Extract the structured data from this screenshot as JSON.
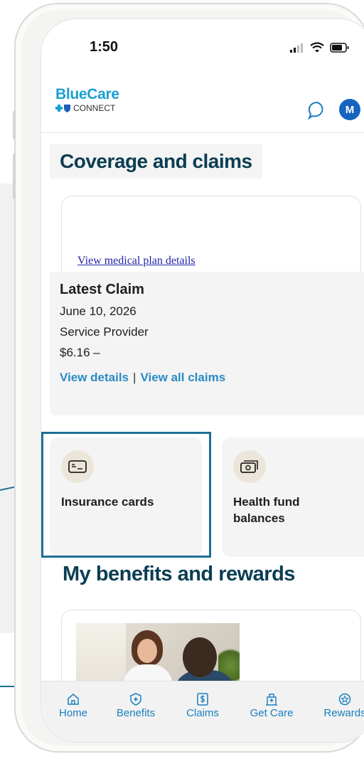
{
  "status_bar": {
    "time": "1:50"
  },
  "header": {
    "brand_name": "BlueCare",
    "brand_sub": "CONNECT",
    "avatar_initial": "M"
  },
  "coverage": {
    "title": "Coverage and claims",
    "plan_link": "View medical plan details"
  },
  "latest_claim": {
    "title": "Latest Claim",
    "date": "June 10, 2026",
    "provider": "Service Provider",
    "amount": "$6.16 –",
    "view_details": "View details",
    "separator": "|",
    "view_all": "View all claims"
  },
  "tiles": [
    {
      "label": "Insurance cards",
      "icon": "card-icon"
    },
    {
      "label": "Health fund balances",
      "icon": "cash-icon"
    }
  ],
  "benefits": {
    "title": "My benefits and rewards"
  },
  "tabbar": [
    {
      "label": "Home",
      "icon": "home-icon"
    },
    {
      "label": "Benefits",
      "icon": "shield-plus-icon"
    },
    {
      "label": "Claims",
      "icon": "dollar-doc-icon"
    },
    {
      "label": "Get Care",
      "icon": "hospital-icon"
    },
    {
      "label": "Rewards",
      "icon": "star-badge-icon"
    }
  ],
  "colors": {
    "brand_blue": "#1a9fd1",
    "heading": "#0b3d52",
    "link": "#2a8bc4",
    "highlight": "#1f6f95"
  }
}
